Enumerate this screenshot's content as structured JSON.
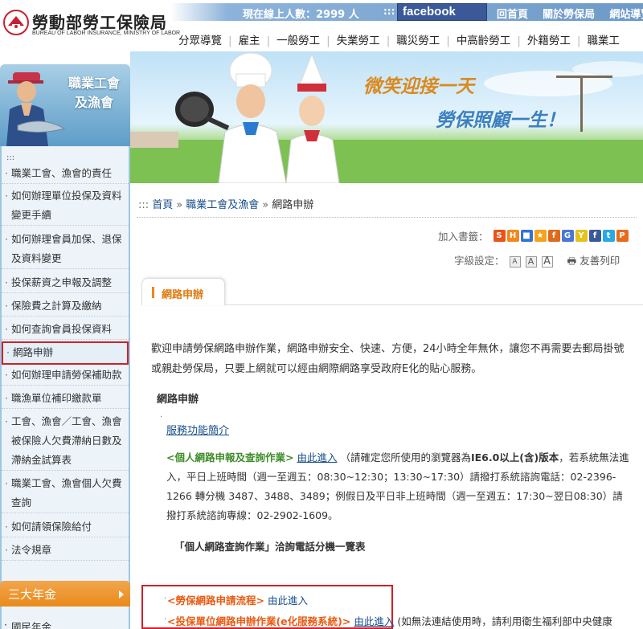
{
  "header": {
    "org_name": "勞動部勞工保險局",
    "org_name_en": "BUREAU OF LABOR INSURANCE, MINISTRY OF LABOR",
    "online_users": "現在線上人數：2999 人",
    "colons": ":::",
    "facebook_label": "facebook",
    "top_links": [
      "回首頁",
      "關於勞保局",
      "網站導覽"
    ],
    "main_nav": [
      "分眾導覽",
      "雇主",
      "一般勞工",
      "失業勞工",
      "職災勞工",
      "中高齡勞工",
      "外籍勞工",
      "職業工"
    ]
  },
  "sidebar": {
    "title_line1": "職業工會",
    "title_line2": "及漁會",
    "colons": ":::",
    "items": [
      "職業工會、漁會的責任",
      "如何辦理單位投保及資料變更手續",
      "如何辦理會員加保、退保及資料變更",
      "投保薪資之申報及調整",
      "保險費之計算及繳納",
      "如何查詢會員投保資料",
      "網路申辦",
      "如何辦理申請勞保補助款",
      "職漁單位補印繳款單",
      "工會、漁會／工會、漁會被保險人欠費滯納日數及滯納金試算表",
      "職業工會、漁會個人欠費查詢",
      "如何請領保險給付",
      "法令規章"
    ],
    "active_index": 6,
    "section_title": "三大年金",
    "section_items": [
      "國民年金"
    ]
  },
  "banner": {
    "slogan1": "微笑迎接一天",
    "slogan2": "勞保照顧一生！"
  },
  "content": {
    "breadcrumb": {
      "prefix": ":::",
      "home": "首頁",
      "parent": "職業工會及漁會",
      "current": "網路申辦",
      "sep": "»"
    },
    "bookmark_label": "加入書籤：",
    "bookmark_icons": [
      {
        "name": "funp-icon",
        "color": "#e8541b",
        "glyph": "S"
      },
      {
        "name": "hemidemi-icon",
        "color": "#f08a1c",
        "glyph": "H"
      },
      {
        "name": "delicious-icon",
        "color": "#3274d0",
        "glyph": "■"
      },
      {
        "name": "myshare-icon",
        "color": "#f5a21c",
        "glyph": "★"
      },
      {
        "name": "udn-icon",
        "color": "#e06a1a",
        "glyph": "f"
      },
      {
        "name": "google-icon",
        "color": "#4a77d4",
        "glyph": "G"
      },
      {
        "name": "yahoo-icon",
        "color": "#e8c21a",
        "glyph": "Y"
      },
      {
        "name": "facebook-icon",
        "color": "#3b5998",
        "glyph": "f"
      },
      {
        "name": "twitter-icon",
        "color": "#29a9e1",
        "glyph": "t"
      },
      {
        "name": "plurk-icon",
        "color": "#e86a1a",
        "glyph": "P"
      }
    ],
    "font_size_label": "字級設定：",
    "font_sizes": [
      "A",
      "A",
      "A"
    ],
    "print_label": "友善列印",
    "tab_label": "網路申辦",
    "intro": "歡迎申請勞保網路申辦作業，網路申辦安全、快速、方便，24小時全年無休，讓您不再需要去郵局掛號或親赴勞保局，只要上網就可以經由網際網路享受政府E化的貼心服務。",
    "section_heading": "網路申辦",
    "func_link": "服務功能簡介",
    "personal": {
      "title": "<個人網路申報及查詢作業>",
      "enter": "由此進入",
      "note_prefix": "（請確定您所使用的瀏覽器為",
      "note_bold": "IE6.0以上(含)版本",
      "note_rest": "，若系統無法進入，平日上班時間（週一至週五：08:30~12:30；13:30~17:30）請撥打系統諮詢電話：02-2396-1266 轉分機 3487、3488、3489；例假日及平日非上班時間（週一至週五：17:30~翌日08:30）請撥打系統諮詢專線：02-2902-1609。"
    },
    "phone_note": "「個人網路查詢作業」洽詢電話分機一覽表",
    "links": [
      {
        "title": "<勞保網路申請流程>",
        "enter": "由此進入",
        "tail": ""
      },
      {
        "title": "<投保單位網路申辦作業(e化服務系統)>",
        "enter": "由此進入",
        "tail": "(如無法連結使用時，請利用衛生福利部中央健康"
      }
    ]
  }
}
